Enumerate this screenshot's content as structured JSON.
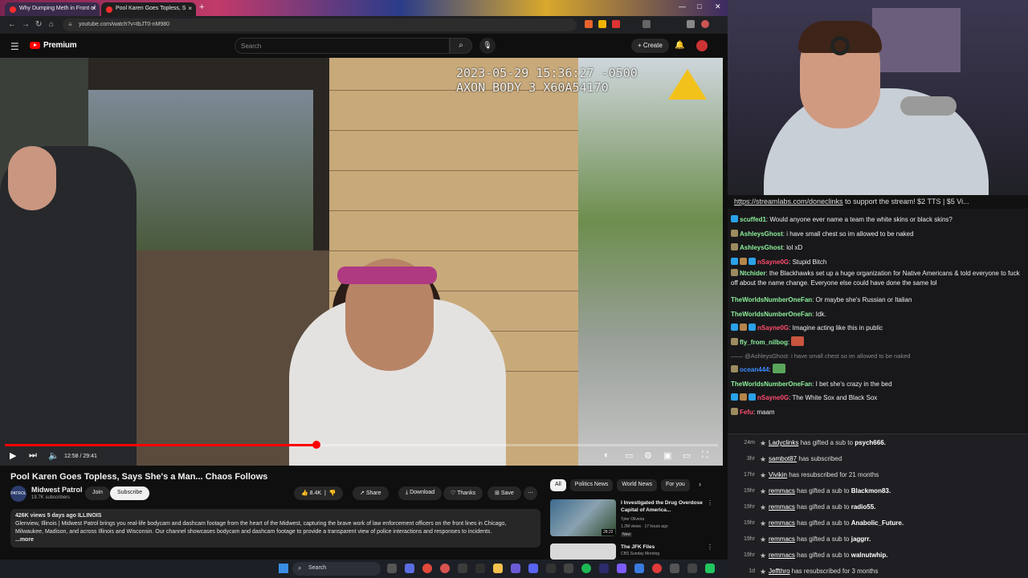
{
  "browser": {
    "tabs": [
      {
        "label": "Why Dumping Meth in Front of"
      },
      {
        "label": "Pool Karen Goes Topless, S"
      }
    ],
    "url": "youtube.com/watch?v=tbJT0-nM980"
  },
  "youtube": {
    "logo": "Premium",
    "search_placeholder": "Search",
    "create_label": "Create"
  },
  "video": {
    "timestamp_line1": "2023-05-29 15:36:27 -0500",
    "timestamp_line2": "AXON BODY 3 X60A54170",
    "time": "12:58 / 29:41",
    "progress": 0.437,
    "title": "Pool Karen Goes Topless, Says She's a Man... Chaos Follows",
    "channel": "Midwest Patrol",
    "channel_avatar_text": "PATROL",
    "subscribers": "19.7K subscribers",
    "join": "Join",
    "subscribe": "Subscribe",
    "likes": "8.4K",
    "share": "Share",
    "download": "Download",
    "thanks": "Thanks",
    "save": "Save",
    "stats": "426K views  5 days ago  ILLINOIS",
    "description": "Glenview, Illinois | Midwest Patrol brings you real-life bodycam and dashcam footage from the heart of the Midwest, capturing the brave work of law enforcement officers on the front lines in Chicago, Milwaukee, Madison, and across Illinois and Wisconsin. Our channel showcases bodycam and dashcam footage to provide a transparent view of police interactions and responses to incidents.",
    "more": "...more"
  },
  "recommendations": {
    "chips": [
      "All",
      "Politics News",
      "World News",
      "For you"
    ],
    "items": [
      {
        "title": "I Investigated the Drug Overdose Capital of America...",
        "channel": "Tyler Oliveira",
        "meta": "1.2M views · 17 hours ago",
        "badge": "New",
        "duration": "28:22"
      },
      {
        "title": "The JFK Files",
        "channel": "CBS Sunday Morning",
        "meta": "",
        "badge": "",
        "duration": ""
      }
    ]
  },
  "taskbar": {
    "search": "Search"
  },
  "stream": {
    "link_text": "https://streamlabs.com/doneclinks",
    "link_rest": " to support the stream! $2 TTS | $5 Vi..."
  },
  "chat": [
    {
      "user": "scuffed1",
      "color": "#8ef09b",
      "text": "Would anyone ever name a team the white skins or black skins?",
      "badges": [
        "#2aa1e8"
      ]
    },
    {
      "user": "AshleysGhost",
      "color": "#8ef09b",
      "text": "i have small chest so im allowed to be naked",
      "badges": [
        "#9c8b5e"
      ]
    },
    {
      "user": "AshleysGhost",
      "color": "#8ef09b",
      "text": "lol xD",
      "badges": [
        "#9c8b5e"
      ]
    },
    {
      "user": "nSayne0G",
      "color": "#ff4d6d",
      "text": "Stupid Bitch",
      "badges": [
        "#2aa1e8",
        "#b5854a",
        "#2aa1e8"
      ]
    },
    {
      "user": "Ntchider",
      "color": "#8ef09b",
      "text": "the Blackhawks set up a huge organization for Native Americans & told everyone to fuck off about the name change. Everyone else could have done the same lol",
      "badges": [
        "#9c8b5e"
      ],
      "wrap": true
    },
    {
      "user": "TheWorldsNumberOneFan",
      "color": "#8ef09b",
      "text": "Or maybe she's Russian or Italian",
      "badges": []
    },
    {
      "user": "TheWorldsNumberOneFan",
      "color": "#8ef09b",
      "text": "Idk.",
      "badges": []
    },
    {
      "user": "nSayne0G",
      "color": "#ff4d6d",
      "text": "Imagine acting like this in public",
      "badges": [
        "#2aa1e8",
        "#b5854a",
        "#2aa1e8"
      ]
    },
    {
      "user": "fly_from_nilbog",
      "color": "#8ef09b",
      "text": "",
      "badges": [
        "#9c8b5e"
      ],
      "emote": "#c9553f"
    },
    {
      "reply": "@AshleysGhost: i have small chest so im allowed to be naked"
    },
    {
      "user": "ocean444",
      "color": "#3d8cff",
      "text": "",
      "badges": [
        "#9c8b5e"
      ],
      "emote": "#5aa55a"
    },
    {
      "user": "TheWorldsNumberOneFan",
      "color": "#8ef09b",
      "text": "I bet she's crazy in the bed",
      "badges": []
    },
    {
      "user": "nSayne0G",
      "color": "#ff4d6d",
      "text": "The White Sox and Black Sox",
      "badges": [
        "#2aa1e8",
        "#b5854a",
        "#2aa1e8"
      ]
    },
    {
      "user": "Fefu",
      "color": "#ff4d6d",
      "text": "maam",
      "badges": [
        "#9c8b5e"
      ]
    }
  ],
  "events": [
    {
      "age": "24m",
      "name": "Ladyclinks",
      "action": " has gifted a sub to ",
      "target": "psych666."
    },
    {
      "age": "3hr",
      "name": "sambot87",
      "action": " has subscribed",
      "target": ""
    },
    {
      "age": "17hr",
      "name": "Vivikin",
      "action": " has resubscribed for 21 months",
      "target": ""
    },
    {
      "age": "19hr",
      "name": "remmacs",
      "action": " has gifted a sub to ",
      "target": "Blackmon83."
    },
    {
      "age": "19hr",
      "name": "remmacs",
      "action": " has gifted a sub to ",
      "target": "radio55."
    },
    {
      "age": "19hr",
      "name": "remmacs",
      "action": " has gifted a sub to ",
      "target": "Anabolic_Future."
    },
    {
      "age": "19hr",
      "name": "remmacs",
      "action": " has gifted a sub to ",
      "target": "jaggrr."
    },
    {
      "age": "19hr",
      "name": "remmacs",
      "action": " has gifted a sub to ",
      "target": "walnutwhip."
    },
    {
      "age": "1d",
      "name": "Jeffthro",
      "action": " has resubscribed for 3 months",
      "target": ""
    }
  ]
}
